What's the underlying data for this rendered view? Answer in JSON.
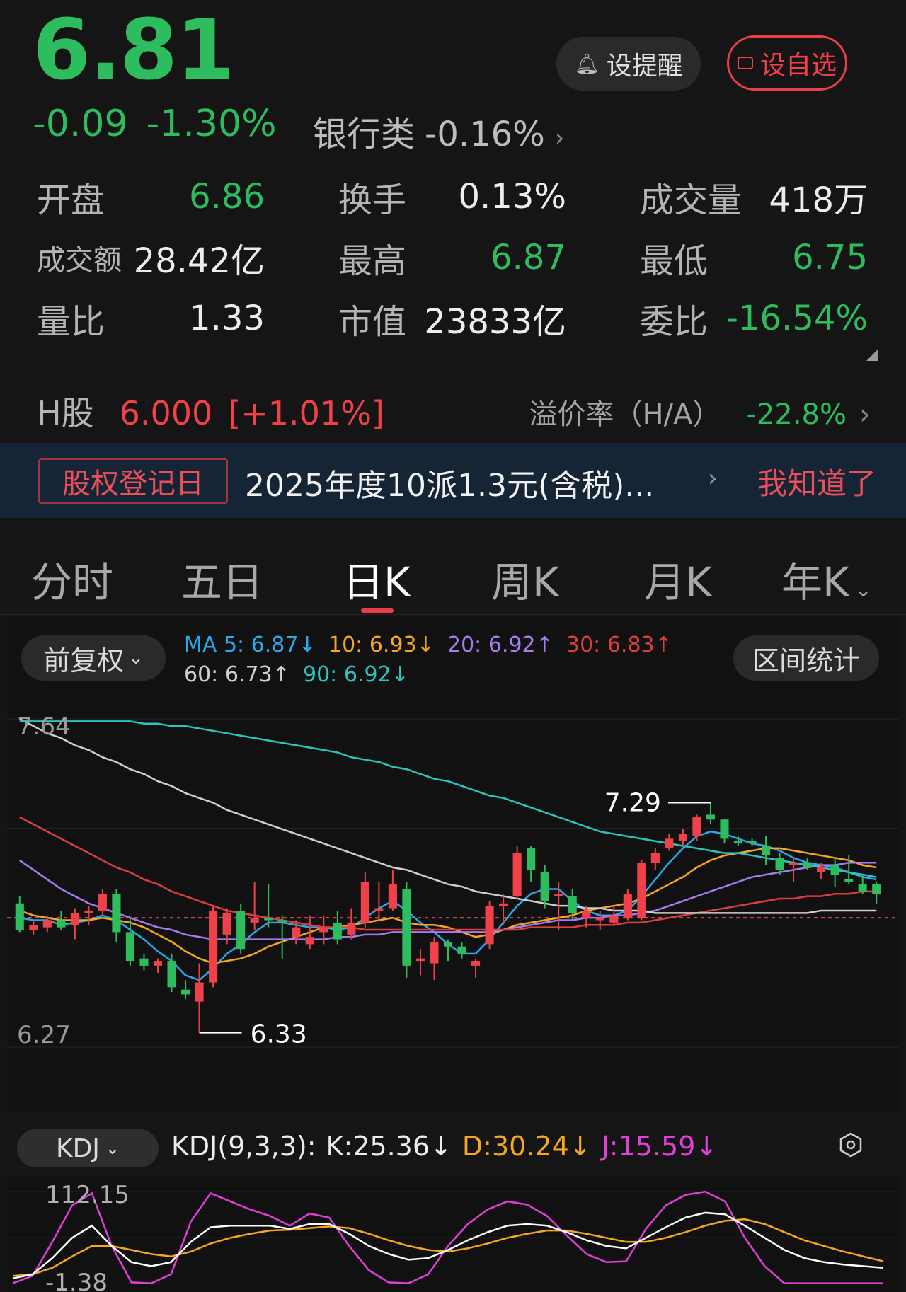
{
  "header": {
    "price": "6.81",
    "change": "-0.09",
    "change_pct": "-1.30%",
    "sector_name": "银行类",
    "sector_pct": "-0.16%",
    "remind_label": "设提醒",
    "favorite_label": "设自选"
  },
  "stats": [
    {
      "label": "开盘",
      "value": "6.86"
    },
    {
      "label": "换手",
      "value": "0.13%"
    },
    {
      "label": "成交量",
      "value": "418万"
    },
    {
      "label": "成交额",
      "value": "28.42亿"
    },
    {
      "label": "最高",
      "value": "6.87"
    },
    {
      "label": "最低",
      "value": "6.75"
    },
    {
      "label": "量比",
      "value": "1.33"
    },
    {
      "label": "市值",
      "value": "23833亿"
    },
    {
      "label": "委比",
      "value": "-16.54%"
    }
  ],
  "hshare": {
    "label": "H股",
    "price": "6.000",
    "pct": "[+1.01%]",
    "premium_label": "溢价率（H/A）",
    "premium_value": "-22.8%"
  },
  "banner": {
    "tag": "股权登记日",
    "text": "2025年度10派1.3元(含税)...",
    "dismiss": "我知道了"
  },
  "tabs": [
    {
      "label": "分时",
      "active": false
    },
    {
      "label": "五日",
      "active": false
    },
    {
      "label": "日K",
      "active": true
    },
    {
      "label": "周K",
      "active": false
    },
    {
      "label": "月K",
      "active": false
    },
    {
      "label": "年K",
      "active": false
    }
  ],
  "controls": {
    "adjust_label": "前复权",
    "range_label": "区间统计",
    "kdj_label": "KDJ"
  },
  "ma": {
    "ma5": "MA 5: 6.87↓",
    "ma10": "10: 6.93↓",
    "ma20": "20: 6.92↑",
    "ma30": "30: 6.83↑",
    "ma60": "60: 6.73↑",
    "ma90": "90: 6.92↓"
  },
  "kdj": {
    "title": "KDJ(9,3,3):",
    "k": "K:25.36↓",
    "d": "D:30.24↓",
    "j": "J:15.59↓"
  },
  "colors": {
    "up": "#f0414a",
    "down": "#2dbd5f",
    "ma5": "#2ba8ea",
    "ma10": "#f5a623",
    "ma20": "#a77bf0",
    "ma30": "#d93f3f",
    "ma60": "#cfcfcf",
    "ma90": "#2bc4c0",
    "kdj_k": "#ffffff",
    "kdj_d": "#f5a623",
    "kdj_j": "#e040d8"
  },
  "chart_data": {
    "type": "candlestick",
    "ylim": [
      6.27,
      7.64
    ],
    "y_labels": {
      "top": "7.64",
      "bottom": "6.27"
    },
    "annotations": {
      "high": "7.29",
      "low": "6.33"
    },
    "ref_line": 6.81,
    "candles": [
      {
        "o": 6.87,
        "h": 6.9,
        "l": 6.75,
        "c": 6.76
      },
      {
        "o": 6.76,
        "h": 6.8,
        "l": 6.74,
        "c": 6.78
      },
      {
        "o": 6.77,
        "h": 6.82,
        "l": 6.75,
        "c": 6.8
      },
      {
        "o": 6.8,
        "h": 6.84,
        "l": 6.76,
        "c": 6.77
      },
      {
        "o": 6.78,
        "h": 6.85,
        "l": 6.72,
        "c": 6.83
      },
      {
        "o": 6.83,
        "h": 6.86,
        "l": 6.78,
        "c": 6.84
      },
      {
        "o": 6.84,
        "h": 6.93,
        "l": 6.82,
        "c": 6.91
      },
      {
        "o": 6.91,
        "h": 6.93,
        "l": 6.71,
        "c": 6.75
      },
      {
        "o": 6.75,
        "h": 6.81,
        "l": 6.61,
        "c": 6.63
      },
      {
        "o": 6.64,
        "h": 6.66,
        "l": 6.59,
        "c": 6.61
      },
      {
        "o": 6.61,
        "h": 6.64,
        "l": 6.58,
        "c": 6.63
      },
      {
        "o": 6.63,
        "h": 6.66,
        "l": 6.5,
        "c": 6.52
      },
      {
        "o": 6.51,
        "h": 6.55,
        "l": 6.47,
        "c": 6.49
      },
      {
        "o": 6.46,
        "h": 6.62,
        "l": 6.33,
        "c": 6.54
      },
      {
        "o": 6.54,
        "h": 6.86,
        "l": 6.52,
        "c": 6.84
      },
      {
        "o": 6.74,
        "h": 6.85,
        "l": 6.7,
        "c": 6.83
      },
      {
        "o": 6.84,
        "h": 6.87,
        "l": 6.66,
        "c": 6.68
      },
      {
        "o": 6.79,
        "h": 6.96,
        "l": 6.76,
        "c": 6.81
      },
      {
        "o": 6.81,
        "h": 6.95,
        "l": 6.77,
        "c": 6.8
      },
      {
        "o": 6.8,
        "h": 6.82,
        "l": 6.64,
        "c": 6.79
      },
      {
        "o": 6.73,
        "h": 6.8,
        "l": 6.7,
        "c": 6.77
      },
      {
        "o": 6.7,
        "h": 6.82,
        "l": 6.68,
        "c": 6.73
      },
      {
        "o": 6.75,
        "h": 6.82,
        "l": 6.7,
        "c": 6.77
      },
      {
        "o": 6.79,
        "h": 6.84,
        "l": 6.7,
        "c": 6.72
      },
      {
        "o": 6.74,
        "h": 6.85,
        "l": 6.72,
        "c": 6.79
      },
      {
        "o": 6.79,
        "h": 7.0,
        "l": 6.77,
        "c": 6.96
      },
      {
        "o": 6.84,
        "h": 6.96,
        "l": 6.8,
        "c": 6.85
      },
      {
        "o": 6.85,
        "h": 7.01,
        "l": 6.84,
        "c": 6.95
      },
      {
        "o": 6.93,
        "h": 6.96,
        "l": 6.56,
        "c": 6.61
      },
      {
        "o": 6.63,
        "h": 6.68,
        "l": 6.57,
        "c": 6.64
      },
      {
        "o": 6.62,
        "h": 6.73,
        "l": 6.55,
        "c": 6.71
      },
      {
        "o": 6.71,
        "h": 6.72,
        "l": 6.63,
        "c": 6.69
      },
      {
        "o": 6.69,
        "h": 6.71,
        "l": 6.64,
        "c": 6.66
      },
      {
        "o": 6.61,
        "h": 6.64,
        "l": 6.56,
        "c": 6.63
      },
      {
        "o": 6.7,
        "h": 6.88,
        "l": 6.68,
        "c": 6.86
      },
      {
        "o": 6.86,
        "h": 6.91,
        "l": 6.78,
        "c": 6.87
      },
      {
        "o": 6.9,
        "h": 7.11,
        "l": 6.89,
        "c": 7.08
      },
      {
        "o": 7.1,
        "h": 7.11,
        "l": 6.96,
        "c": 7.01
      },
      {
        "o": 7.0,
        "h": 7.03,
        "l": 6.85,
        "c": 6.88
      },
      {
        "o": 6.9,
        "h": 6.96,
        "l": 6.76,
        "c": 6.91
      },
      {
        "o": 6.9,
        "h": 6.93,
        "l": 6.8,
        "c": 6.83
      },
      {
        "o": 6.81,
        "h": 6.86,
        "l": 6.77,
        "c": 6.84
      },
      {
        "o": 6.8,
        "h": 6.84,
        "l": 6.76,
        "c": 6.81
      },
      {
        "o": 6.79,
        "h": 6.86,
        "l": 6.78,
        "c": 6.82
      },
      {
        "o": 6.81,
        "h": 6.93,
        "l": 6.8,
        "c": 6.91
      },
      {
        "o": 6.81,
        "h": 7.05,
        "l": 6.8,
        "c": 7.04
      },
      {
        "o": 7.04,
        "h": 7.1,
        "l": 7.01,
        "c": 7.08
      },
      {
        "o": 7.1,
        "h": 7.16,
        "l": 7.09,
        "c": 7.14
      },
      {
        "o": 7.13,
        "h": 7.18,
        "l": 7.11,
        "c": 7.16
      },
      {
        "o": 7.15,
        "h": 7.24,
        "l": 7.13,
        "c": 7.23
      },
      {
        "o": 7.24,
        "h": 7.29,
        "l": 7.2,
        "c": 7.22
      },
      {
        "o": 7.22,
        "h": 7.22,
        "l": 7.12,
        "c": 7.14
      },
      {
        "o": 7.13,
        "h": 7.15,
        "l": 7.11,
        "c": 7.12
      },
      {
        "o": 7.13,
        "h": 7.14,
        "l": 7.11,
        "c": 7.12
      },
      {
        "o": 7.11,
        "h": 7.15,
        "l": 7.03,
        "c": 7.07
      },
      {
        "o": 7.06,
        "h": 7.08,
        "l": 6.99,
        "c": 7.01
      },
      {
        "o": 7.03,
        "h": 7.06,
        "l": 6.96,
        "c": 7.04
      },
      {
        "o": 7.04,
        "h": 7.06,
        "l": 7.01,
        "c": 7.02
      },
      {
        "o": 7.0,
        "h": 7.04,
        "l": 6.97,
        "c": 7.02
      },
      {
        "o": 7.03,
        "h": 7.06,
        "l": 6.94,
        "c": 6.99
      },
      {
        "o": 6.97,
        "h": 7.07,
        "l": 6.95,
        "c": 6.96
      },
      {
        "o": 6.95,
        "h": 6.99,
        "l": 6.91,
        "c": 6.92
      },
      {
        "o": 6.95,
        "h": 6.96,
        "l": 6.87,
        "c": 6.91
      }
    ],
    "ma_lines": {
      "ma5": [
        6.81,
        6.8,
        6.8,
        6.78,
        6.79,
        6.8,
        6.82,
        6.8,
        6.76,
        6.72,
        6.67,
        6.63,
        6.57,
        6.55,
        6.6,
        6.66,
        6.7,
        6.75,
        6.79,
        6.79,
        6.78,
        6.77,
        6.77,
        6.76,
        6.77,
        6.81,
        6.85,
        6.88,
        6.84,
        6.79,
        6.75,
        6.7,
        6.66,
        6.66,
        6.72,
        6.79,
        6.86,
        6.91,
        6.93,
        6.93,
        6.88,
        6.84,
        6.82,
        6.82,
        6.84,
        6.9,
        6.97,
        7.04,
        7.1,
        7.15,
        7.17,
        7.16,
        7.14,
        7.12,
        7.11,
        7.09,
        7.06,
        7.04,
        7.03,
        7.02,
        7.0,
        6.98,
        6.97
      ],
      "ma10": [
        6.84,
        6.82,
        6.81,
        6.8,
        6.8,
        6.8,
        6.81,
        6.8,
        6.79,
        6.77,
        6.74,
        6.71,
        6.67,
        6.64,
        6.62,
        6.63,
        6.64,
        6.66,
        6.69,
        6.71,
        6.73,
        6.75,
        6.77,
        6.77,
        6.78,
        6.79,
        6.8,
        6.81,
        6.79,
        6.78,
        6.78,
        6.77,
        6.75,
        6.73,
        6.74,
        6.76,
        6.78,
        6.79,
        6.8,
        6.81,
        6.82,
        6.84,
        6.85,
        6.86,
        6.87,
        6.89,
        6.92,
        6.95,
        6.98,
        7.02,
        7.05,
        7.07,
        7.08,
        7.09,
        7.1,
        7.1,
        7.09,
        7.08,
        7.07,
        7.06,
        7.05,
        7.03,
        7.02
      ],
      "ma20": [
        7.05,
        7.01,
        6.97,
        6.93,
        6.9,
        6.87,
        6.85,
        6.83,
        6.81,
        6.79,
        6.77,
        6.76,
        6.74,
        6.73,
        6.72,
        6.72,
        6.72,
        6.72,
        6.72,
        6.72,
        6.72,
        6.72,
        6.72,
        6.73,
        6.73,
        6.74,
        6.74,
        6.75,
        6.75,
        6.75,
        6.75,
        6.75,
        6.75,
        6.75,
        6.75,
        6.76,
        6.77,
        6.78,
        6.79,
        6.8,
        6.8,
        6.81,
        6.81,
        6.82,
        6.82,
        6.83,
        6.84,
        6.86,
        6.88,
        6.9,
        6.92,
        6.94,
        6.96,
        6.98,
        6.99,
        7.0,
        7.01,
        7.02,
        7.03,
        7.03,
        7.04,
        7.04,
        7.04
      ],
      "ma30": [
        7.23,
        7.2,
        7.17,
        7.14,
        7.11,
        7.08,
        7.05,
        7.02,
        7.0,
        6.97,
        6.95,
        6.92,
        6.9,
        6.88,
        6.86,
        6.84,
        6.83,
        6.82,
        6.81,
        6.8,
        6.79,
        6.78,
        6.77,
        6.77,
        6.77,
        6.76,
        6.76,
        6.76,
        6.76,
        6.76,
        6.76,
        6.76,
        6.76,
        6.76,
        6.76,
        6.76,
        6.76,
        6.77,
        6.77,
        6.77,
        6.77,
        6.78,
        6.78,
        6.78,
        6.79,
        6.79,
        6.8,
        6.81,
        6.82,
        6.83,
        6.84,
        6.85,
        6.86,
        6.87,
        6.88,
        6.89,
        6.89,
        6.9,
        6.9,
        6.91,
        6.91,
        6.92,
        6.92
      ],
      "ma60": [
        7.64,
        7.61,
        7.58,
        7.56,
        7.53,
        7.51,
        7.48,
        7.46,
        7.43,
        7.41,
        7.38,
        7.36,
        7.33,
        7.31,
        7.29,
        7.26,
        7.24,
        7.22,
        7.2,
        7.18,
        7.16,
        7.14,
        7.12,
        7.1,
        7.08,
        7.06,
        7.04,
        7.02,
        7.01,
        6.99,
        6.97,
        6.95,
        6.94,
        6.92,
        6.91,
        6.9,
        6.89,
        6.88,
        6.87,
        6.86,
        6.86,
        6.85,
        6.85,
        6.84,
        6.84,
        6.84,
        6.83,
        6.83,
        6.83,
        6.83,
        6.83,
        6.83,
        6.83,
        6.83,
        6.83,
        6.83,
        6.83,
        6.83,
        6.84,
        6.84,
        6.84,
        6.84,
        6.84
      ],
      "ma90": [
        7.63,
        7.63,
        7.63,
        7.63,
        7.63,
        7.63,
        7.63,
        7.63,
        7.63,
        7.62,
        7.62,
        7.61,
        7.61,
        7.6,
        7.59,
        7.58,
        7.57,
        7.56,
        7.55,
        7.54,
        7.53,
        7.52,
        7.51,
        7.5,
        7.48,
        7.47,
        7.46,
        7.44,
        7.43,
        7.41,
        7.39,
        7.38,
        7.36,
        7.34,
        7.32,
        7.31,
        7.29,
        7.27,
        7.25,
        7.23,
        7.21,
        7.19,
        7.17,
        7.16,
        7.15,
        7.14,
        7.13,
        7.12,
        7.11,
        7.1,
        7.09,
        7.08,
        7.08,
        7.07,
        7.06,
        7.05,
        7.04,
        7.03,
        7.02,
        7.01,
        7.0,
        6.99,
        6.98
      ]
    },
    "kdj_chart": {
      "ylim": [
        -1.38,
        112.15
      ],
      "y_labels": {
        "top": "112.15",
        "bottom": "-1.38"
      },
      "k": [
        5,
        10,
        30,
        55,
        70,
        45,
        25,
        20,
        25,
        50,
        68,
        70,
        70,
        70,
        66,
        72,
        72,
        60,
        45,
        35,
        28,
        30,
        40,
        52,
        62,
        70,
        72,
        70,
        62,
        52,
        45,
        42,
        55,
        68,
        80,
        86,
        84,
        70,
        55,
        40,
        30,
        25,
        22,
        20,
        18
      ],
      "d": [
        8,
        10,
        18,
        32,
        45,
        45,
        40,
        35,
        32,
        38,
        48,
        55,
        60,
        64,
        65,
        67,
        69,
        67,
        60,
        52,
        45,
        40,
        38,
        42,
        48,
        55,
        60,
        64,
        64,
        60,
        55,
        50,
        50,
        55,
        62,
        70,
        76,
        78,
        72,
        62,
        52,
        45,
        38,
        32,
        26
      ],
      "j": [
        -1,
        8,
        50,
        95,
        110,
        45,
        0,
        -1,
        10,
        75,
        110,
        100,
        90,
        82,
        70,
        85,
        80,
        45,
        15,
        0,
        -1,
        10,
        45,
        72,
        90,
        100,
        96,
        82,
        58,
        35,
        25,
        26,
        66,
        95,
        108,
        112,
        100,
        55,
        20,
        -1,
        -1,
        -1,
        -1,
        -1,
        -1
      ]
    }
  }
}
